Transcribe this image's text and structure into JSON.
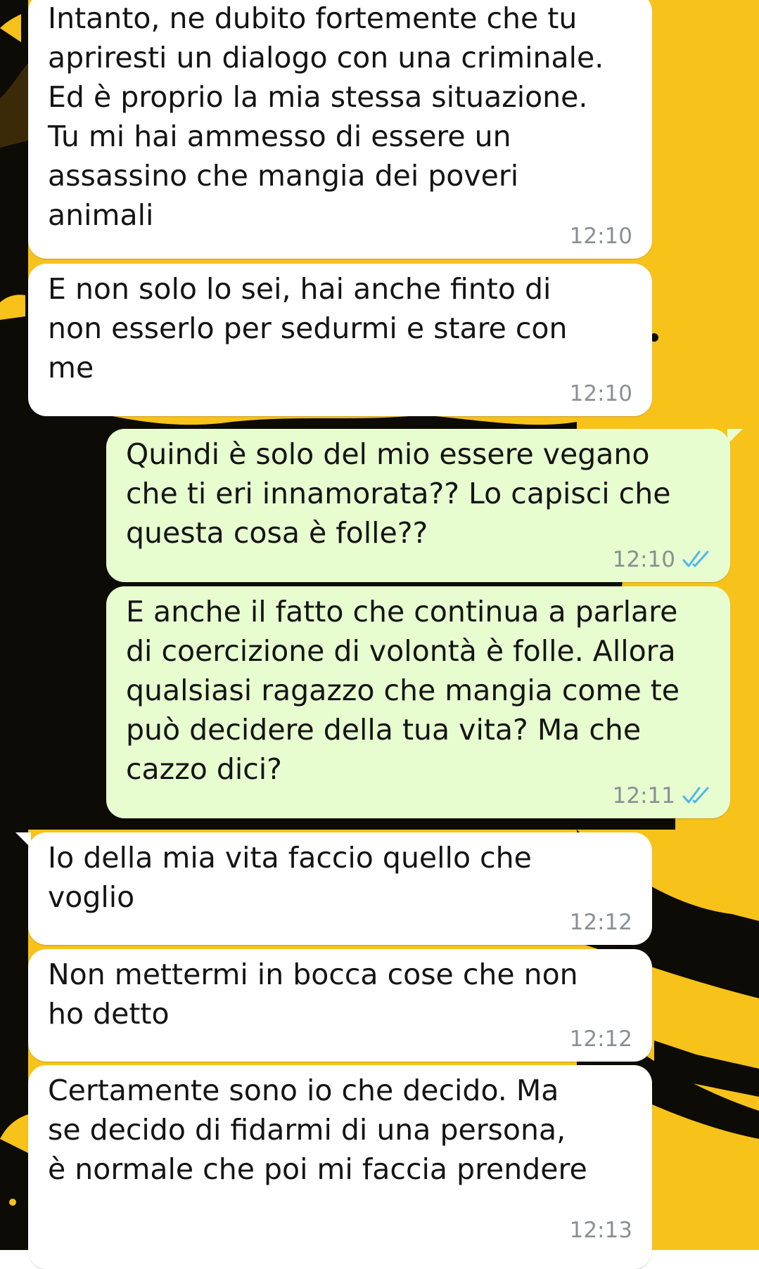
{
  "theme": {
    "wallpaper_color": "#f7c21a",
    "incoming_bubble_color": "#ffffff",
    "outgoing_bubble_color": "#e7fccf",
    "timestamp_color": "#8a8f93",
    "read_tick_color": "#4fb6ec"
  },
  "messages": [
    {
      "direction": "incoming",
      "text": "Intanto, ne dubito fortemente che tu\napriresti un dialogo con una criminale.\nEd è proprio la mia stessa situazione.\nTu mi hai ammesso di essere un\nassassino che mangia dei poveri\nanimali",
      "time": "12:10"
    },
    {
      "direction": "incoming",
      "text": "E non solo lo sei, hai anche finto di\nnon esserlo per sedurmi e stare con\nme",
      "time": "12:10"
    },
    {
      "direction": "outgoing",
      "text": "Quindi è solo del mio essere vegano\nche ti eri innamorata?? Lo capisci che\nquesta cosa è folle??",
      "time": "12:10",
      "status": "read-double-check-icon"
    },
    {
      "direction": "outgoing",
      "text": "E anche il fatto che continua a parlare\ndi coercizione di volontà è folle. Allora\nqualsiasi ragazzo che mangia come te\npuò decidere della tua vita? Ma che\ncazzo dici?",
      "time": "12:11",
      "status": "read-double-check-icon"
    },
    {
      "direction": "incoming",
      "text": "Io della mia vita faccio quello che\nvoglio",
      "time": "12:12"
    },
    {
      "direction": "incoming",
      "text": "Non mettermi in bocca cose che non\nho detto",
      "time": "12:12"
    },
    {
      "direction": "incoming",
      "text": "Certamente sono io che decido. Ma\nse decido di fidarmi di una persona,\nè normale che poi mi faccia prendere",
      "time": "12:13"
    }
  ]
}
